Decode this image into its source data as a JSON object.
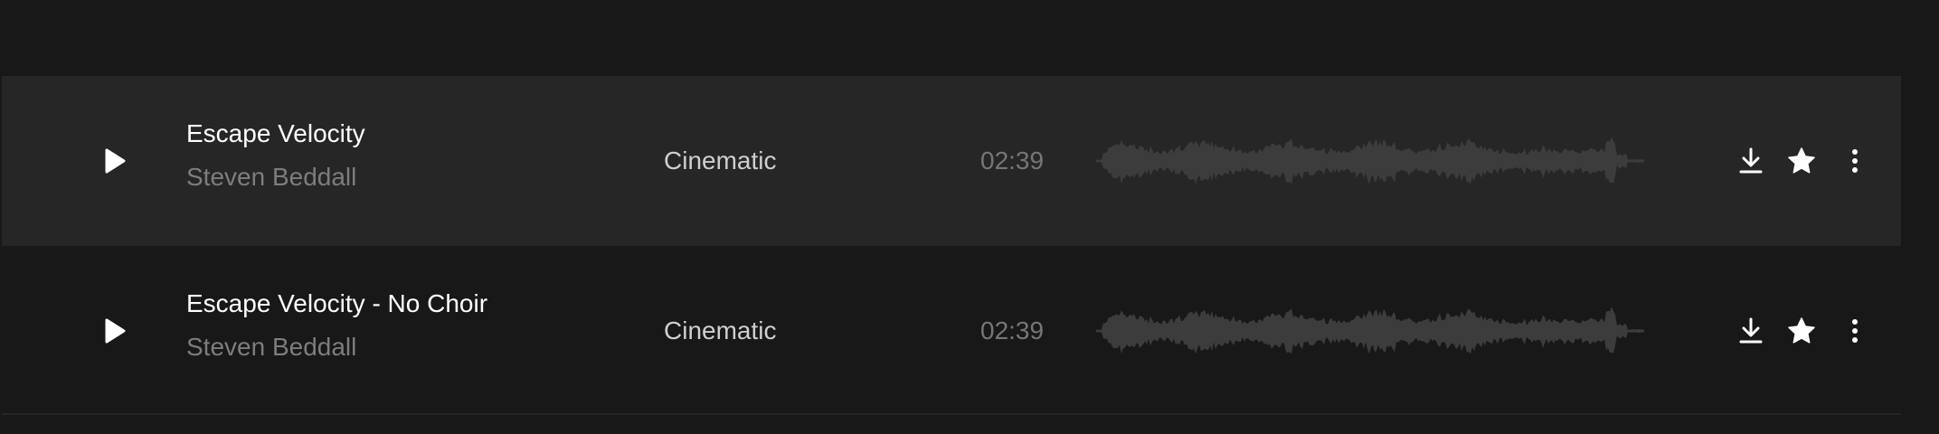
{
  "colors": {
    "background": "#181818",
    "row_highlight": "#262626",
    "title_text": "#ffffff",
    "artist_text": "#7d7d7d",
    "genre_text": "#cfcfcf",
    "duration_text": "#767676",
    "waveform": "#3c3c3c"
  },
  "tracks": [
    {
      "title": "Escape Velocity",
      "artist": "Steven Beddall",
      "genre": "Cinematic",
      "duration": "02:39",
      "highlighted": true,
      "icons": {
        "play": "play-icon",
        "download": "download-icon",
        "favorite": "star-icon",
        "more": "more-vertical-icon"
      }
    },
    {
      "title": "Escape Velocity - No Choir",
      "artist": "Steven Beddall",
      "genre": "Cinematic",
      "duration": "02:39",
      "highlighted": false,
      "icons": {
        "play": "play-icon",
        "download": "download-icon",
        "favorite": "star-icon",
        "more": "more-vertical-icon"
      }
    }
  ]
}
